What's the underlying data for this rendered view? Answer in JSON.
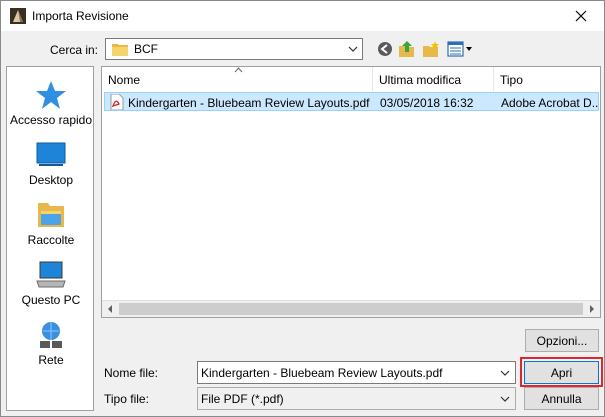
{
  "window": {
    "title": "Importa Revisione"
  },
  "lookin": {
    "label": "Cerca in:",
    "value": "BCF"
  },
  "places": [
    {
      "label": "Accesso rapido"
    },
    {
      "label": "Desktop"
    },
    {
      "label": "Raccolte"
    },
    {
      "label": "Questo PC"
    },
    {
      "label": "Rete"
    }
  ],
  "columns": {
    "name": "Nome",
    "modified": "Ultima modifica",
    "type": "Tipo"
  },
  "files": [
    {
      "name": "Kindergarten - Bluebeam Review Layouts.pdf",
      "modified": "03/05/2018 16:32",
      "type": "Adobe Acrobat D..."
    }
  ],
  "buttons": {
    "options": "Opzioni...",
    "open": "Apri",
    "cancel": "Annulla"
  },
  "filename": {
    "label": "Nome file:",
    "value": "Kindergarten - Bluebeam Review Layouts.pdf"
  },
  "filetype": {
    "label": "Tipo file:",
    "value": "File PDF (*.pdf)"
  },
  "colors": {
    "selection": "#cce8ff",
    "accent": "#0078d7",
    "highlight": "#e0262c"
  }
}
